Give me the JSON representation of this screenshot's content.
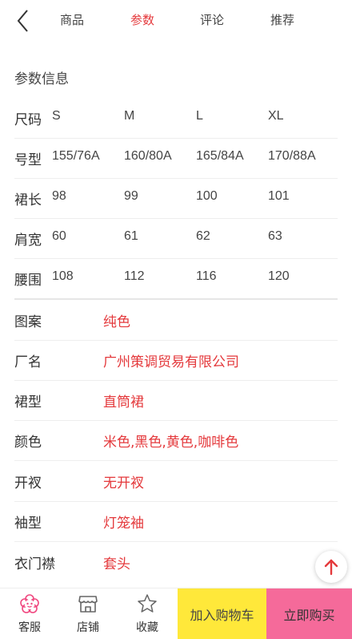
{
  "tabs": [
    {
      "label": "商品"
    },
    {
      "label": "参数"
    },
    {
      "label": "评论"
    },
    {
      "label": "推荐"
    }
  ],
  "active_tab": "参数",
  "section_title": "参数信息",
  "size_table": {
    "rows": [
      {
        "label": "尺码",
        "values": [
          "S",
          "M",
          "L",
          "XL"
        ]
      },
      {
        "label": "号型",
        "values": [
          "155/76A",
          "160/80A",
          "165/84A",
          "170/88A"
        ]
      },
      {
        "label": "裙长",
        "values": [
          "98",
          "99",
          "100",
          "101"
        ]
      },
      {
        "label": "肩宽",
        "values": [
          "60",
          "61",
          "62",
          "63"
        ]
      },
      {
        "label": "腰围",
        "values": [
          "108",
          "112",
          "116",
          "120"
        ]
      }
    ]
  },
  "attributes": [
    {
      "label": "图案",
      "value": "纯色"
    },
    {
      "label": "厂名",
      "value": "广州策调贸易有限公司"
    },
    {
      "label": "裙型",
      "value": "直筒裙"
    },
    {
      "label": "颜色",
      "value": "米色,黑色,黄色,咖啡色"
    },
    {
      "label": "开衩",
      "value": "无开衩"
    },
    {
      "label": "袖型",
      "value": "灯笼袖"
    },
    {
      "label": "衣门襟",
      "value": "套头"
    }
  ],
  "bottom_bar": {
    "service_label": "客服",
    "shop_label": "店铺",
    "favorite_label": "收藏",
    "cart_label": "加入购物车",
    "buy_label": "立即购买"
  },
  "colors": {
    "accent": "#e4393c",
    "cart_button": "#ffe83a",
    "buy_button": "#f56a9a",
    "service_icon": "#f0477f"
  },
  "icons": {
    "back": "chevron-left-icon",
    "service": "flower-icon",
    "shop": "store-icon",
    "favorite": "star-icon",
    "scroll_top": "arrow-up-icon"
  }
}
